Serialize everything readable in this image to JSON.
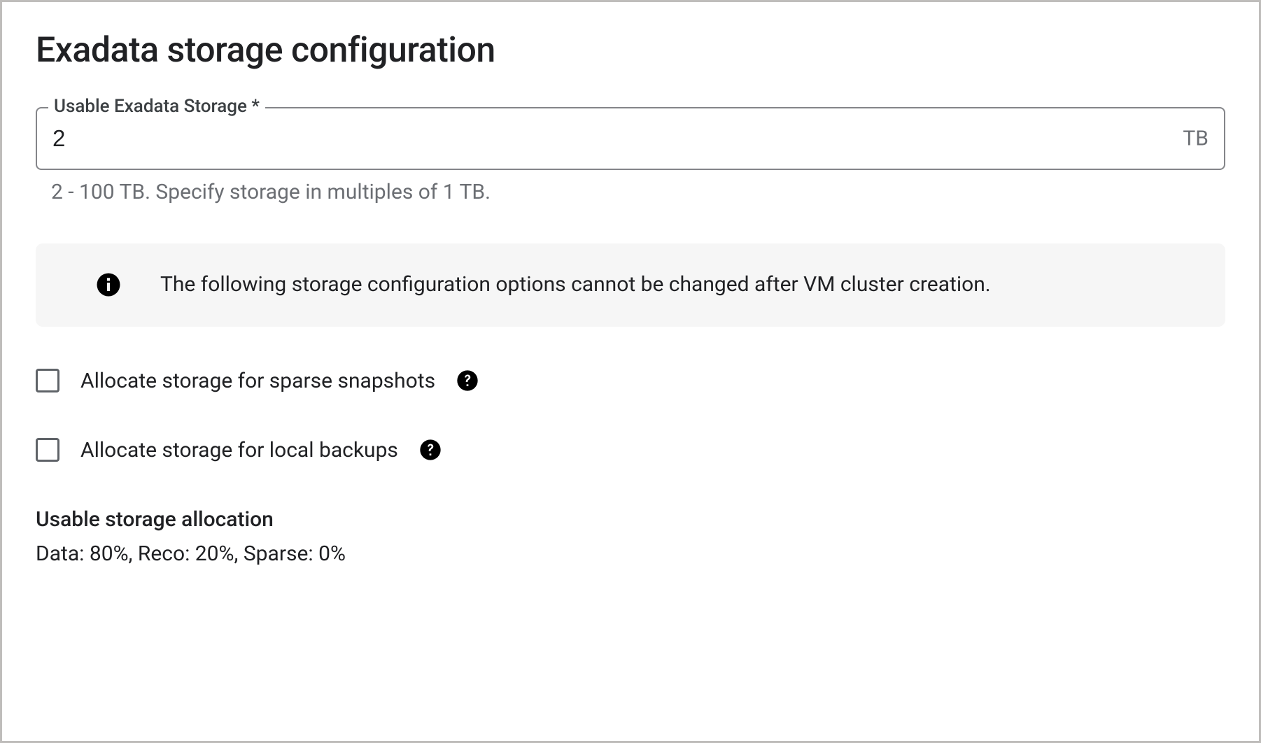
{
  "section": {
    "title": "Exadata storage configuration"
  },
  "storageField": {
    "label": "Usable Exadata Storage *",
    "value": "2",
    "suffix": "TB",
    "helper": "2 - 100 TB. Specify storage in multiples of 1 TB."
  },
  "infoBanner": {
    "text": "The following storage configuration options cannot be changed after VM cluster creation."
  },
  "options": {
    "sparse": {
      "label": "Allocate storage for sparse snapshots",
      "checked": false
    },
    "backups": {
      "label": "Allocate storage for local backups",
      "checked": false
    }
  },
  "allocation": {
    "title": "Usable storage allocation",
    "text": "Data: 80%, Reco: 20%, Sparse: 0%"
  }
}
